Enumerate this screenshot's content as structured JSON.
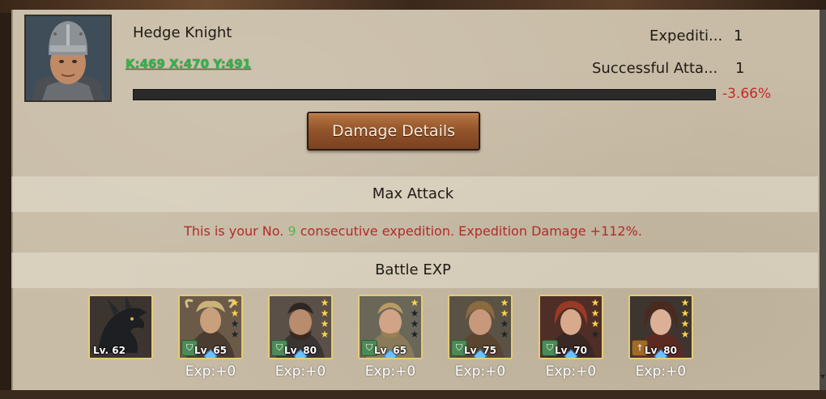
{
  "commander": {
    "name": "Hedge Knight",
    "coords": "K:469 X:470 Y:491"
  },
  "stats": {
    "expedition_label": "Expediti...",
    "expedition_value": "1",
    "attack_label": "Successful Atta...",
    "attack_value": "1"
  },
  "damage_bar": {
    "percent_text": "-3.66%",
    "fill_fraction": 0
  },
  "damage_button": {
    "label": "Damage Details"
  },
  "max_attack": {
    "title": "Max Attack"
  },
  "expedition_message": {
    "prefix": "This is your No.",
    "number": "9",
    "suffix": "consecutive expedition. Expedition Damage +112%."
  },
  "battle_exp": {
    "title": "Battle EXP",
    "units": [
      {
        "type": "dragon",
        "level": "Lv. 62",
        "stars": null,
        "badge": null,
        "exp": ""
      },
      {
        "type": "hero",
        "level": "Lv. 65",
        "stars": 2,
        "badge": "shield",
        "exp": "Exp:+0"
      },
      {
        "type": "hero",
        "level": "Lv. 80",
        "stars": 4,
        "badge": "shield",
        "exp": "Exp:+0"
      },
      {
        "type": "hero",
        "level": "Lv. 65",
        "stars": 1,
        "badge": "shield",
        "exp": "Exp:+0"
      },
      {
        "type": "hero",
        "level": "Lv. 75",
        "stars": 2,
        "badge": "shield",
        "exp": "Exp:+0"
      },
      {
        "type": "hero",
        "level": "Lv. 70",
        "stars": 3,
        "badge": "shield",
        "exp": "Exp:+0"
      },
      {
        "type": "hero",
        "level": "Lv. 80",
        "stars": 4,
        "badge": "sword",
        "exp": "Exp:+0"
      }
    ]
  },
  "colors": {
    "panel": "#c8bca6",
    "coords_green": "#33b34a",
    "negative_red": "#c42a2a",
    "button_brown": "#94552b",
    "star_gold": "#ffd24a"
  }
}
